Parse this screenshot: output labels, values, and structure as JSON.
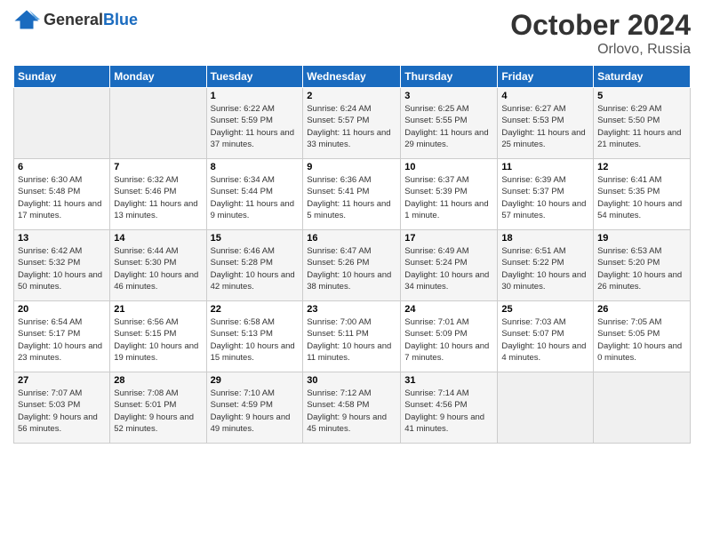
{
  "logo": {
    "general": "General",
    "blue": "Blue"
  },
  "title": "October 2024",
  "location": "Orlovo, Russia",
  "days_header": [
    "Sunday",
    "Monday",
    "Tuesday",
    "Wednesday",
    "Thursday",
    "Friday",
    "Saturday"
  ],
  "weeks": [
    [
      {
        "num": "",
        "info": ""
      },
      {
        "num": "",
        "info": ""
      },
      {
        "num": "1",
        "info": "Sunrise: 6:22 AM\nSunset: 5:59 PM\nDaylight: 11 hours and 37 minutes."
      },
      {
        "num": "2",
        "info": "Sunrise: 6:24 AM\nSunset: 5:57 PM\nDaylight: 11 hours and 33 minutes."
      },
      {
        "num": "3",
        "info": "Sunrise: 6:25 AM\nSunset: 5:55 PM\nDaylight: 11 hours and 29 minutes."
      },
      {
        "num": "4",
        "info": "Sunrise: 6:27 AM\nSunset: 5:53 PM\nDaylight: 11 hours and 25 minutes."
      },
      {
        "num": "5",
        "info": "Sunrise: 6:29 AM\nSunset: 5:50 PM\nDaylight: 11 hours and 21 minutes."
      }
    ],
    [
      {
        "num": "6",
        "info": "Sunrise: 6:30 AM\nSunset: 5:48 PM\nDaylight: 11 hours and 17 minutes."
      },
      {
        "num": "7",
        "info": "Sunrise: 6:32 AM\nSunset: 5:46 PM\nDaylight: 11 hours and 13 minutes."
      },
      {
        "num": "8",
        "info": "Sunrise: 6:34 AM\nSunset: 5:44 PM\nDaylight: 11 hours and 9 minutes."
      },
      {
        "num": "9",
        "info": "Sunrise: 6:36 AM\nSunset: 5:41 PM\nDaylight: 11 hours and 5 minutes."
      },
      {
        "num": "10",
        "info": "Sunrise: 6:37 AM\nSunset: 5:39 PM\nDaylight: 11 hours and 1 minute."
      },
      {
        "num": "11",
        "info": "Sunrise: 6:39 AM\nSunset: 5:37 PM\nDaylight: 10 hours and 57 minutes."
      },
      {
        "num": "12",
        "info": "Sunrise: 6:41 AM\nSunset: 5:35 PM\nDaylight: 10 hours and 54 minutes."
      }
    ],
    [
      {
        "num": "13",
        "info": "Sunrise: 6:42 AM\nSunset: 5:32 PM\nDaylight: 10 hours and 50 minutes."
      },
      {
        "num": "14",
        "info": "Sunrise: 6:44 AM\nSunset: 5:30 PM\nDaylight: 10 hours and 46 minutes."
      },
      {
        "num": "15",
        "info": "Sunrise: 6:46 AM\nSunset: 5:28 PM\nDaylight: 10 hours and 42 minutes."
      },
      {
        "num": "16",
        "info": "Sunrise: 6:47 AM\nSunset: 5:26 PM\nDaylight: 10 hours and 38 minutes."
      },
      {
        "num": "17",
        "info": "Sunrise: 6:49 AM\nSunset: 5:24 PM\nDaylight: 10 hours and 34 minutes."
      },
      {
        "num": "18",
        "info": "Sunrise: 6:51 AM\nSunset: 5:22 PM\nDaylight: 10 hours and 30 minutes."
      },
      {
        "num": "19",
        "info": "Sunrise: 6:53 AM\nSunset: 5:20 PM\nDaylight: 10 hours and 26 minutes."
      }
    ],
    [
      {
        "num": "20",
        "info": "Sunrise: 6:54 AM\nSunset: 5:17 PM\nDaylight: 10 hours and 23 minutes."
      },
      {
        "num": "21",
        "info": "Sunrise: 6:56 AM\nSunset: 5:15 PM\nDaylight: 10 hours and 19 minutes."
      },
      {
        "num": "22",
        "info": "Sunrise: 6:58 AM\nSunset: 5:13 PM\nDaylight: 10 hours and 15 minutes."
      },
      {
        "num": "23",
        "info": "Sunrise: 7:00 AM\nSunset: 5:11 PM\nDaylight: 10 hours and 11 minutes."
      },
      {
        "num": "24",
        "info": "Sunrise: 7:01 AM\nSunset: 5:09 PM\nDaylight: 10 hours and 7 minutes."
      },
      {
        "num": "25",
        "info": "Sunrise: 7:03 AM\nSunset: 5:07 PM\nDaylight: 10 hours and 4 minutes."
      },
      {
        "num": "26",
        "info": "Sunrise: 7:05 AM\nSunset: 5:05 PM\nDaylight: 10 hours and 0 minutes."
      }
    ],
    [
      {
        "num": "27",
        "info": "Sunrise: 7:07 AM\nSunset: 5:03 PM\nDaylight: 9 hours and 56 minutes."
      },
      {
        "num": "28",
        "info": "Sunrise: 7:08 AM\nSunset: 5:01 PM\nDaylight: 9 hours and 52 minutes."
      },
      {
        "num": "29",
        "info": "Sunrise: 7:10 AM\nSunset: 4:59 PM\nDaylight: 9 hours and 49 minutes."
      },
      {
        "num": "30",
        "info": "Sunrise: 7:12 AM\nSunset: 4:58 PM\nDaylight: 9 hours and 45 minutes."
      },
      {
        "num": "31",
        "info": "Sunrise: 7:14 AM\nSunset: 4:56 PM\nDaylight: 9 hours and 41 minutes."
      },
      {
        "num": "",
        "info": ""
      },
      {
        "num": "",
        "info": ""
      }
    ]
  ]
}
